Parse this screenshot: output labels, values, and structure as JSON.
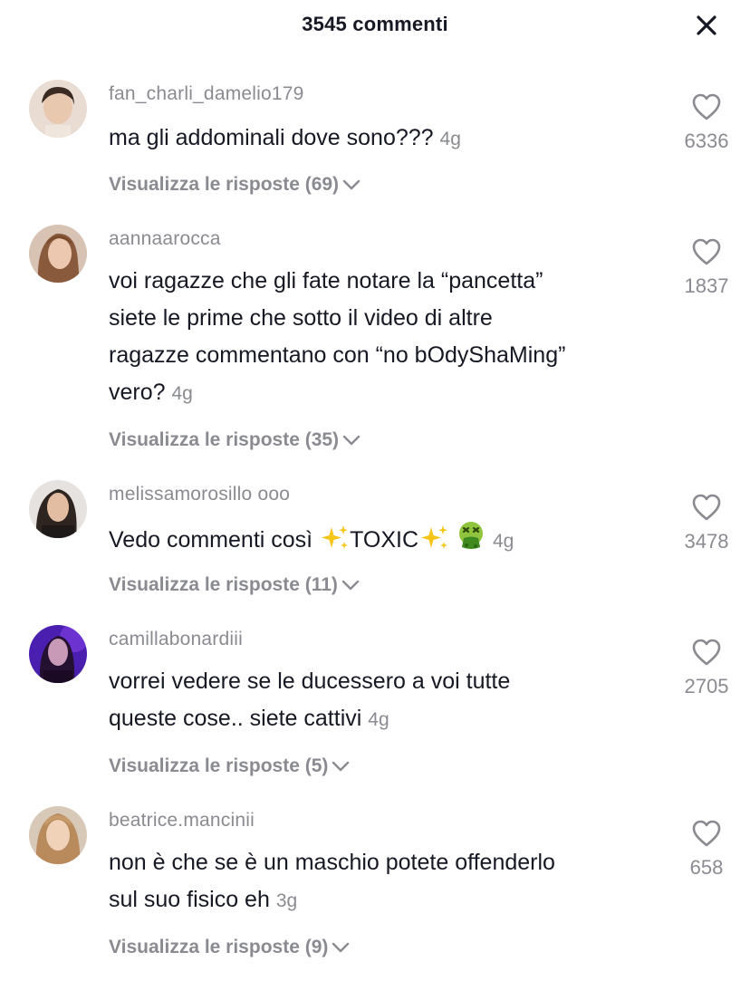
{
  "header": {
    "title": "3545 commenti",
    "close_icon": "close-icon"
  },
  "comments": [
    {
      "username": "fan_charli_damelio179",
      "lines": [
        "ma gli addominali dove sono???"
      ],
      "time": "4g",
      "replies": "Visualizza le risposte (69)",
      "likes": "6336",
      "avatar_color": "#d9c6b8"
    },
    {
      "username": "aannaarocca",
      "lines": [
        "voi ragazze che gli fate notare la “pancetta”",
        "siete le prime che sotto il video di altre",
        "ragazze commentano con “no bOdyShaMing”",
        "vero?"
      ],
      "time": "4g",
      "replies": "Visualizza le risposte (35)",
      "likes": "1837",
      "avatar_color": "#c9a58c"
    },
    {
      "username": "melissamorosillo ooo",
      "lines": [
        "Vedo commenti così"
      ],
      "toxic": "TOXIC",
      "time": "4g",
      "replies": "Visualizza le risposte (11)",
      "likes": "3478",
      "avatar_color": "#5a4a44"
    },
    {
      "username": "camillabonardiii",
      "lines": [
        "vorrei vedere se le ducessero a voi tutte",
        "queste cose.. siete cattivi"
      ],
      "time": "4g",
      "replies": "Visualizza le risposte (5)",
      "likes": "2705",
      "avatar_color": "#3a1a8a"
    },
    {
      "username": "beatrice.mancinii",
      "lines": [
        "non è che se è un maschio potete offenderlo",
        "sul suo fisico eh"
      ],
      "time": "3g",
      "replies": "Visualizza le risposte (9)",
      "likes": "658",
      "avatar_color": "#c9a27a"
    }
  ]
}
